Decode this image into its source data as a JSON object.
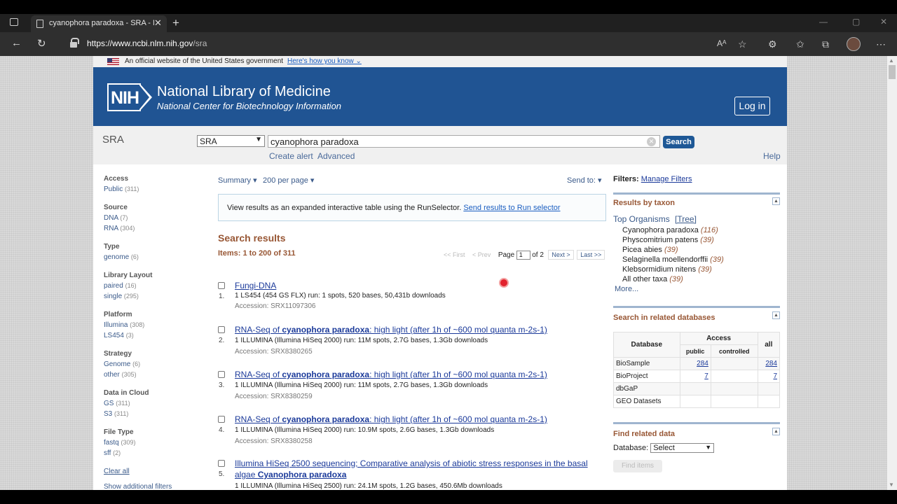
{
  "browser": {
    "tab_title": "cyanophora paradoxa - SRA - NCBI",
    "new_tab": "+",
    "close_tab": "✕",
    "url_host": "https://www.ncbi.nlm.nih.gov",
    "url_path": "/sra"
  },
  "gov_banner": {
    "text": "An official website of the United States government",
    "link": "Here's how you know ⌄"
  },
  "header": {
    "logo": "NIH",
    "title": "National Library of Medicine",
    "subtitle": "National Center for Biotechnology Information",
    "login": "Log in"
  },
  "search": {
    "db_title": "SRA",
    "db_selected": "SRA",
    "query": "cyanophora paradoxa",
    "button": "Search",
    "create_alert": "Create alert",
    "advanced": "Advanced",
    "help": "Help"
  },
  "filters": [
    {
      "heading": "Access",
      "items": [
        {
          "label": "Public",
          "count": "(311)"
        }
      ]
    },
    {
      "heading": "Source",
      "items": [
        {
          "label": "DNA",
          "count": "(7)"
        },
        {
          "label": "RNA",
          "count": "(304)"
        }
      ]
    },
    {
      "heading": "Type",
      "items": [
        {
          "label": "genome",
          "count": "(6)"
        }
      ]
    },
    {
      "heading": "Library Layout",
      "items": [
        {
          "label": "paired",
          "count": "(16)"
        },
        {
          "label": "single",
          "count": "(295)"
        }
      ]
    },
    {
      "heading": "Platform",
      "items": [
        {
          "label": "Illumina",
          "count": "(308)"
        },
        {
          "label": "LS454",
          "count": "(3)"
        }
      ]
    },
    {
      "heading": "Strategy",
      "items": [
        {
          "label": "Genome",
          "count": "(6)"
        },
        {
          "label": "other",
          "count": "(305)"
        }
      ]
    },
    {
      "heading": "Data in Cloud",
      "items": [
        {
          "label": "GS",
          "count": "(311)"
        },
        {
          "label": "S3",
          "count": "(311)"
        }
      ]
    },
    {
      "heading": "File Type",
      "items": [
        {
          "label": "fastq",
          "count": "(309)"
        },
        {
          "label": "sff",
          "count": "(2)"
        }
      ]
    }
  ],
  "clear_all": "Clear all",
  "show_more_filters": "Show additional filters",
  "results_header": {
    "summary": "Summary ▾",
    "per_page": "200 per page ▾",
    "send_to": "Send to: ▾",
    "runselector_text": "View results as an expanded interactive table using the RunSelector.",
    "runselector_link": "Send results to Run selector",
    "heading": "Search results",
    "items": "Items: 1 to 200 of 311",
    "first": "<< First",
    "prev": "< Prev",
    "page_label": "Page",
    "page_value": "1",
    "of": "of 2",
    "next": "Next >",
    "last": "Last >>"
  },
  "results": [
    {
      "num": "1.",
      "title_pre": "Fungi-DNA",
      "title_bold": "",
      "title_post": "",
      "desc": "1 LS454 (454 GS FLX) run: 1 spots, 520 bases, 50,431b downloads",
      "acc": "Accession: SRX11097306"
    },
    {
      "num": "2.",
      "title_pre": "RNA-Seq of ",
      "title_bold": "cyanophora paradoxa",
      "title_post": ": high light (after 1h of ~600 mol quanta m-2s-1)",
      "desc": "1 ILLUMINA (Illumina HiSeq 2000) run: 11M spots, 2.7G bases, 1.3Gb downloads",
      "acc": "Accession: SRX8380265"
    },
    {
      "num": "3.",
      "title_pre": "RNA-Seq of ",
      "title_bold": "cyanophora paradoxa",
      "title_post": ": high light (after 1h of ~600 mol quanta m-2s-1)",
      "desc": "1 ILLUMINA (Illumina HiSeq 2000) run: 11M spots, 2.7G bases, 1.3Gb downloads",
      "acc": "Accession: SRX8380259"
    },
    {
      "num": "4.",
      "title_pre": "RNA-Seq of ",
      "title_bold": "cyanophora paradoxa",
      "title_post": ": high light (after 1h of ~600 mol quanta m-2s-1)",
      "desc": "1 ILLUMINA (Illumina HiSeq 2000) run: 10.9M spots, 2.6G bases, 1.3Gb downloads",
      "acc": "Accession: SRX8380258"
    },
    {
      "num": "5.",
      "title_pre": "Illumina HiSeq 2500 sequencing; Comparative analysis of abiotic stress responses in the basal algae ",
      "title_bold": "Cyanophora paradoxa",
      "title_post": "",
      "desc": "1 ILLUMINA (Illumina HiSeq 2500) run: 24.1M spots, 1.2G bases, 450.6Mb downloads",
      "acc": ""
    }
  ],
  "right": {
    "filters_label": "Filters:",
    "manage_filters": "Manage Filters",
    "taxon_title": "Results by taxon",
    "top_organisms": "Top Organisms",
    "tree": "[Tree]",
    "taxa": [
      {
        "name": "Cyanophora paradoxa",
        "count": "(116)"
      },
      {
        "name": "Physcomitrium patens",
        "count": "(39)"
      },
      {
        "name": "Picea abies",
        "count": "(39)"
      },
      {
        "name": "Selaginella moellendorffii",
        "count": "(39)"
      },
      {
        "name": "Klebsormidium nitens",
        "count": "(39)"
      },
      {
        "name": "All other taxa",
        "count": "(39)"
      }
    ],
    "more": "More...",
    "related_title": "Search in related databases",
    "table": {
      "database": "Database",
      "access": "Access",
      "public": "public",
      "controlled": "controlled",
      "all": "all",
      "rows": [
        {
          "db": "BioSample",
          "public": "284",
          "controlled": "",
          "all": "284"
        },
        {
          "db": "BioProject",
          "public": "7",
          "controlled": "",
          "all": "7"
        },
        {
          "db": "dbGaP",
          "public": "",
          "controlled": "",
          "all": ""
        },
        {
          "db": "GEO Datasets",
          "public": "",
          "controlled": "",
          "all": ""
        }
      ]
    },
    "find_title": "Find related data",
    "db_label": "Database:",
    "db_select": "Select",
    "find_items": "Find items"
  }
}
